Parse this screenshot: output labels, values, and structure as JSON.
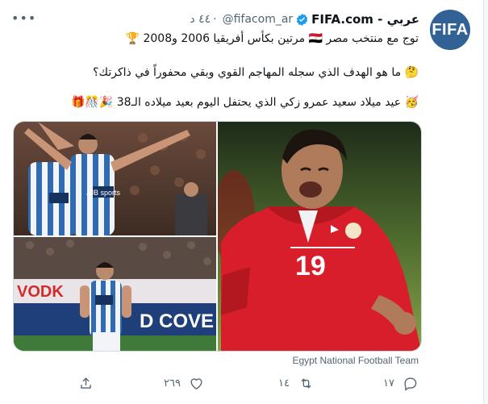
{
  "account": {
    "display_name": "عربي - FIFA.com",
    "handle": "@fifacom_ar",
    "separator": "·",
    "time": "٤٤ د",
    "avatar_text": "FIFA"
  },
  "tweet": {
    "line1": "توج مع منتخب مصر 🇪🇬 مرتين بكأس أفريقيا 2006 و2008 🏆",
    "line2": "🤔 ما هو الهدف الذي سجله المهاجم القوي وبقي محفوراً في ذاكرتك؟",
    "line3": "🥳 عيد ميلاد سعيد عمرو زكي الذي يحتفل اليوم بعيد ميلاده الـ38 🎉🎊🎁"
  },
  "media": {
    "caption": "Egypt National Football Team",
    "shirt_sponsor": "JJB sports",
    "shirt_number": "19",
    "ad_board_text": "VODK",
    "ad_board_text_2": "D COVE"
  },
  "actions": {
    "reply_count": "١٧",
    "retweet_count": "١٤",
    "like_count": "٢٦٩"
  },
  "colors": {
    "brand_blue": "#326295",
    "verified": "#1d9bf0",
    "egypt_red": "#d81e2a",
    "wigan_blue": "#2f6ab5"
  }
}
